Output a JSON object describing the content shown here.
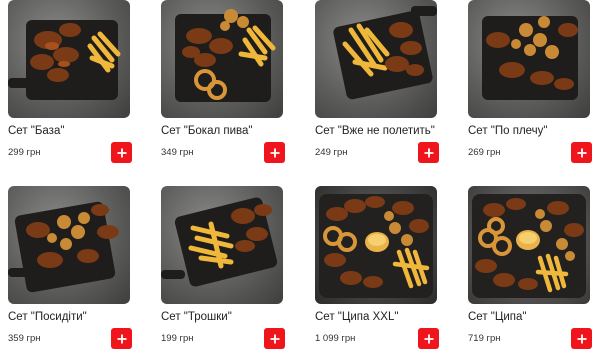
{
  "products": [
    {
      "name": "Сет \"База\"",
      "price": "299 грн",
      "photo_icon": "wings-fries-board"
    },
    {
      "name": "Сет \"Бокал пива\"",
      "price": "349 грн",
      "photo_icon": "wings-rings-fries-board"
    },
    {
      "name": "Сет \"Вже не полетить\"",
      "price": "249 грн",
      "photo_icon": "fries-wings-board"
    },
    {
      "name": "Сет \"По плечу\"",
      "price": "269 грн",
      "photo_icon": "wings-nuggets-board"
    },
    {
      "name": "Сет \"Посидіти\"",
      "price": "359 грн",
      "photo_icon": "wings-nuggets-board"
    },
    {
      "name": "Сет \"Трошки\"",
      "price": "199 грн",
      "photo_icon": "fries-wings-board"
    },
    {
      "name": "Сет \"Ципа XXL\"",
      "price": "1 099 грн",
      "photo_icon": "platter-sauce-rings-fries"
    },
    {
      "name": "Сет \"Ципа\"",
      "price": "719 грн",
      "photo_icon": "platter-sauce-rings-fries"
    }
  ],
  "add_button": {
    "icon": "plus-icon",
    "color": "#f0141d"
  }
}
